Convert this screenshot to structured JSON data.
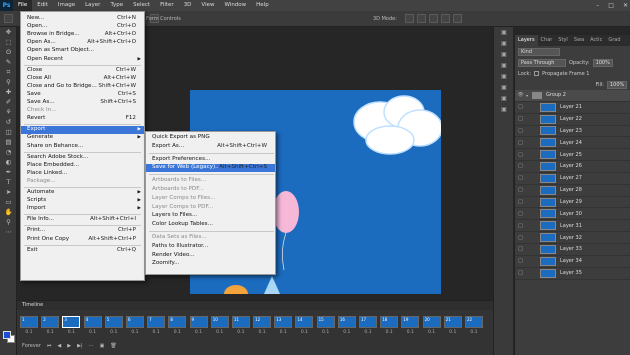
{
  "menubar": {
    "logo": "Ps",
    "items": [
      "File",
      "Edit",
      "Image",
      "Layer",
      "Type",
      "Select",
      "Filter",
      "3D",
      "View",
      "Window",
      "Help"
    ],
    "active_index": 0
  },
  "window_controls": [
    "–",
    "□",
    "✕"
  ],
  "options_bar": {
    "form_controls": "Form Controls",
    "mode_3d": "3D Mode:"
  },
  "file_menu": {
    "items": [
      {
        "label": "New...",
        "shortcut": "Ctrl+N"
      },
      {
        "label": "Open...",
        "shortcut": "Ctrl+O"
      },
      {
        "label": "Browse in Bridge...",
        "shortcut": "Alt+Ctrl+O"
      },
      {
        "label": "Open As...",
        "shortcut": "Alt+Shift+Ctrl+O"
      },
      {
        "label": "Open as Smart Object..."
      },
      {
        "label": "Open Recent",
        "submenu": true
      },
      {
        "label": "Close",
        "shortcut": "Ctrl+W"
      },
      {
        "label": "Close All",
        "shortcut": "Alt+Ctrl+W"
      },
      {
        "label": "Close and Go to Bridge...",
        "shortcut": "Shift+Ctrl+W"
      },
      {
        "label": "Save",
        "shortcut": "Ctrl+S"
      },
      {
        "label": "Save As...",
        "shortcut": "Shift+Ctrl+S"
      },
      {
        "label": "Check In...",
        "disabled": true
      },
      {
        "label": "Revert",
        "shortcut": "F12"
      },
      {
        "label": "Export",
        "submenu": true,
        "highlighted": true
      },
      {
        "label": "Generate",
        "submenu": true
      },
      {
        "label": "Share on Behance..."
      },
      {
        "label": "Search Adobe Stock..."
      },
      {
        "label": "Place Embedded..."
      },
      {
        "label": "Place Linked..."
      },
      {
        "label": "Package...",
        "disabled": true
      },
      {
        "label": "Automate",
        "submenu": true
      },
      {
        "label": "Scripts",
        "submenu": true
      },
      {
        "label": "Import",
        "submenu": true
      },
      {
        "label": "File Info...",
        "shortcut": "Alt+Shift+Ctrl+I"
      },
      {
        "label": "Print...",
        "shortcut": "Ctrl+P"
      },
      {
        "label": "Print One Copy",
        "shortcut": "Alt+Shift+Ctrl+P"
      },
      {
        "label": "Exit",
        "shortcut": "Ctrl+Q"
      }
    ]
  },
  "export_submenu": {
    "items": [
      {
        "label": "Quick Export as PNG"
      },
      {
        "label": "Export As...",
        "shortcut": "Alt+Shift+Ctrl+W"
      },
      {
        "label": "Export Preferences..."
      },
      {
        "label": "Save for Web (Legacy)...",
        "shortcut": "Alt+Shift+Ctrl+S",
        "highlighted": true
      },
      {
        "label": "Artboards to Files...",
        "disabled": true
      },
      {
        "label": "Artboards to PDF...",
        "disabled": true
      },
      {
        "label": "Layer Comps to Files...",
        "disabled": true
      },
      {
        "label": "Layer Comps to PDF...",
        "disabled": true
      },
      {
        "label": "Layers to Files..."
      },
      {
        "label": "Color Lookup Tables..."
      },
      {
        "label": "Data Sets as Files...",
        "disabled": true
      },
      {
        "label": "Paths to Illustrator..."
      },
      {
        "label": "Render Video..."
      },
      {
        "label": "Zoomify..."
      }
    ]
  },
  "layers_panel": {
    "tabs": [
      "Layers",
      "Char",
      "Styl",
      "Swa",
      "Actic",
      "Grad"
    ],
    "kind_label": "Kind",
    "blend_mode": "Pass Through",
    "opacity_label": "Opacity:",
    "opacity_value": "100%",
    "lock_label": "Lock:",
    "fill_label": "Fill:",
    "fill_value": "100%",
    "propagate_label": "Propagate Frame 1",
    "group_name": "Group 2",
    "layers": [
      "Layer 21",
      "Layer 22",
      "Layer 23",
      "Layer 24",
      "Layer 25",
      "Layer 26",
      "Layer 27",
      "Layer 28",
      "Layer 29",
      "Layer 30",
      "Layer 31",
      "Layer 32",
      "Layer 33",
      "Layer 34",
      "Layer 35"
    ]
  },
  "timeline": {
    "title": "Timeline",
    "frame_count": 22,
    "frame_delay": "0.1",
    "selected_frame": 3,
    "loop": "Forever"
  },
  "colors": {
    "canvas": "#1b6bbf",
    "highlight": "#3b76d8",
    "foreground": "#1a4fd6"
  }
}
